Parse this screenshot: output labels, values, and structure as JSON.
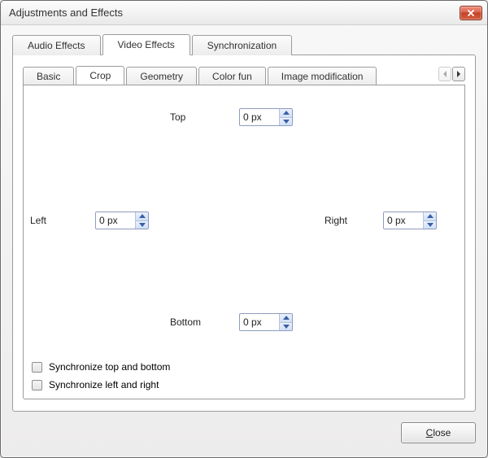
{
  "window": {
    "title": "Adjustments and Effects"
  },
  "mainTabs": {
    "audio": "Audio Effects",
    "video": "Video Effects",
    "sync": "Synchronization",
    "activeIndex": 1
  },
  "subTabs": {
    "basic": "Basic",
    "crop": "Crop",
    "geometry": "Geometry",
    "colorfun": "Color fun",
    "imagemod": "Image modification",
    "activeIndex": 1
  },
  "crop": {
    "top": {
      "label": "Top",
      "value": "0 px"
    },
    "left": {
      "label": "Left",
      "value": "0 px"
    },
    "right": {
      "label": "Right",
      "value": "0 px"
    },
    "bottom": {
      "label": "Bottom",
      "value": "0 px"
    },
    "syncTB": {
      "label": "Synchronize top and bottom",
      "checked": false
    },
    "syncLR": {
      "label": "Synchronize left and right",
      "checked": false
    }
  },
  "buttons": {
    "close": "Close"
  }
}
